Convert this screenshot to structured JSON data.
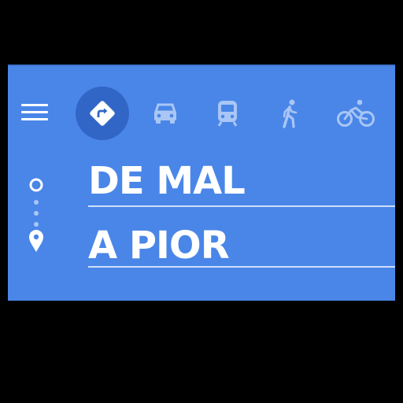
{
  "menu": {
    "icon": "menu-icon"
  },
  "travel_modes": [
    {
      "icon": "directions-icon",
      "selected": true
    },
    {
      "icon": "car-icon",
      "selected": false
    },
    {
      "icon": "transit-icon",
      "selected": false
    },
    {
      "icon": "walk-icon",
      "selected": false
    },
    {
      "icon": "bike-icon",
      "selected": false
    }
  ],
  "route": {
    "origin": "DE MAL",
    "destination": "A PIOR"
  },
  "colors": {
    "panel": "#4a86e8",
    "selected_mode_bg": "#3166c7",
    "inactive_icon": "#a9c6f5",
    "text": "#ffffff"
  }
}
